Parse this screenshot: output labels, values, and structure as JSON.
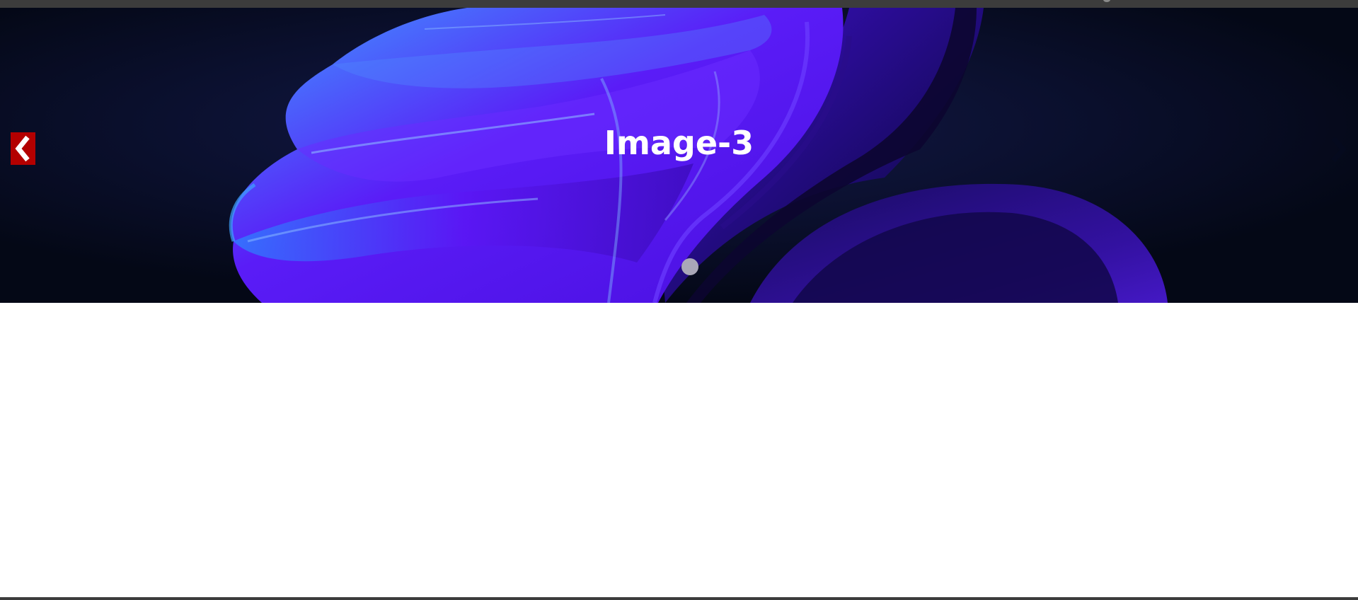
{
  "slider": {
    "caption": "Image-3",
    "prev_icon": "chevron-left-icon",
    "next_icon": "chevron-right-icon",
    "prev_button_color": "#b30000",
    "next_arrow_color": "#050a1e",
    "indicator_color": "#a9a7b8",
    "indicators": 1,
    "active_indicator": 1
  },
  "colors": {
    "background_dark": "#050a1e",
    "accent_violet": "#5a14f5",
    "accent_blue": "#2f7cff",
    "top_bar": "#3c3c3c"
  }
}
